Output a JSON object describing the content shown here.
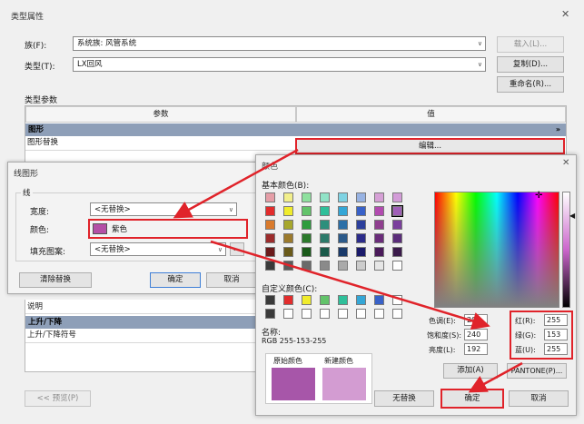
{
  "type_props": {
    "title": "类型属性",
    "family_label": "族(F):",
    "family_value": "系统族: 风管系统",
    "type_label": "类型(T):",
    "type_value": "LX回风",
    "load_btn": "载入(L)...",
    "duplicate_btn": "复制(D)...",
    "rename_btn": "重命名(R)...",
    "params_label": "类型参数",
    "col_param": "参数",
    "col_value": "值",
    "group_graphics": "图形",
    "row_graphic_override": "图形替换",
    "edit_btn": "编辑...",
    "row_desc": "说明",
    "group_riser": "上升/下降",
    "row_riser_symbol": "上升/下降符号",
    "preview_btn": "<< 预览(P)"
  },
  "line_graphics": {
    "title": "线图形",
    "group_label": "线",
    "width_label": "宽度:",
    "width_value": "<无替换>",
    "color_label": "颜色:",
    "color_value": "紫色",
    "color_hex": "#b44fa6",
    "pattern_label": "填充图案:",
    "pattern_value": "<无替换>",
    "clear_btn": "清除替换",
    "ok_btn": "确定",
    "cancel_btn": "取消"
  },
  "color_dialog": {
    "title": "颜色",
    "basic_label": "基本颜色(B):",
    "custom_label": "自定义颜色(C):",
    "name_label": "名称:",
    "name_value": "RGB 255-153-255",
    "orig_label": "原始颜色",
    "new_label": "新建颜色",
    "hue_label": "色调(E):",
    "hue_value": "200",
    "sat_label": "饱和度(S):",
    "sat_value": "240",
    "lum_label": "亮度(L):",
    "lum_value": "192",
    "red_label": "红(R):",
    "red_value": "255",
    "green_label": "绿(G):",
    "green_value": "153",
    "blue_label": "蓝(U):",
    "blue_value": "255",
    "add_btn": "添加(A)",
    "pantone_btn": "PANTONE(P)...",
    "none_btn": "无替换",
    "ok_btn": "确定",
    "cancel_btn": "取消",
    "orig_color": "#a756a9",
    "new_color": "#d39cd2",
    "basic_colors": [
      "#e59ea7",
      "#f2ef8c",
      "#8ee09e",
      "#90e3c7",
      "#7fd3e3",
      "#98b3e3",
      "#d6a0d6",
      "#d39cd8",
      "#e22c2c",
      "#f0ec2c",
      "#62c36a",
      "#2fbf9a",
      "#34a6d6",
      "#3861c8",
      "#b24bb0",
      "#a05fb8",
      "#d97a2c",
      "#a7a72c",
      "#2e9c3e",
      "#2c8f7c",
      "#2c6fa7",
      "#2c3f9c",
      "#8f3f8f",
      "#7a3f9c",
      "#9c2c2c",
      "#9c7a2c",
      "#2c7a2c",
      "#2c7a6a",
      "#2c5a8a",
      "#2c2c8a",
      "#6a2c7a",
      "#5a2c7a",
      "#6a1a1a",
      "#6a5a1a",
      "#1a5a1a",
      "#1a5a4a",
      "#1a3a6a",
      "#1a1a6a",
      "#4a1a5a",
      "#3a1a4a",
      "#3a3a3a",
      "#5a5a5a",
      "#6a6a6a",
      "#8a8a8a",
      "#aaaaaa",
      "#cccccc",
      "#e6e6e6",
      "#ffffff"
    ],
    "custom_colors": [
      "#3a3a3a",
      "#e22c2c",
      "#f0ec2c",
      "#62c36a",
      "#2fbf9a",
      "#34a6d6",
      "#3861c8",
      "#ffffff",
      "#3a3a3a",
      "#ffffff",
      "#ffffff",
      "#ffffff",
      "#ffffff",
      "#ffffff",
      "#ffffff",
      "#ffffff"
    ]
  }
}
